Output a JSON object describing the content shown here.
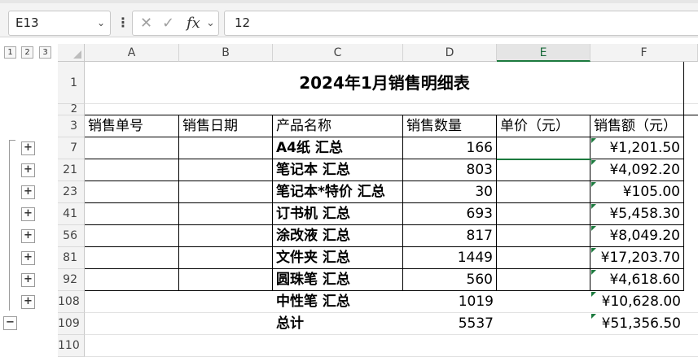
{
  "formula_bar": {
    "name_box": "E13",
    "more_glyph": "⋮",
    "cancel_glyph": "✕",
    "enter_glyph": "✓",
    "fx_label": "fx",
    "fx_dropdown": "⌄",
    "formula_value": "12"
  },
  "outline": {
    "levels": [
      "1",
      "2",
      "3"
    ],
    "expand_glyph": "+",
    "collapse_glyph": "−"
  },
  "columns": [
    "A",
    "B",
    "C",
    "D",
    "E",
    "F"
  ],
  "selected_column": "E",
  "rows": [
    "1",
    "2",
    "3",
    "7",
    "21",
    "23",
    "41",
    "56",
    "81",
    "92",
    "108",
    "109",
    "110"
  ],
  "sheet": {
    "title": "2024年1月销售明细表",
    "headers": [
      "销售单号",
      "销售日期",
      "产品名称",
      "销售数量",
      "单价（元）",
      "销售额（元）"
    ],
    "data": [
      {
        "name": "A4纸 汇总",
        "qty": "166",
        "amount": "¥1,201.50"
      },
      {
        "name": "笔记本 汇总",
        "qty": "803",
        "amount": "¥4,092.20"
      },
      {
        "name": "笔记本*特价 汇总",
        "qty": "30",
        "amount": "¥105.00"
      },
      {
        "name": "订书机 汇总",
        "qty": "693",
        "amount": "¥5,458.30"
      },
      {
        "name": "涂改液 汇总",
        "qty": "817",
        "amount": "¥8,049.20"
      },
      {
        "name": "文件夹 汇总",
        "qty": "1449",
        "amount": "¥17,203.70"
      },
      {
        "name": "圆珠笔 汇总",
        "qty": "560",
        "amount": "¥4,618.60"
      },
      {
        "name": "中性笔 汇总",
        "qty": "1019",
        "amount": "¥10,628.00"
      },
      {
        "name": "总计",
        "qty": "5537",
        "amount": "¥51,356.50"
      }
    ]
  },
  "colors": {
    "accent_green": "#1c7a3e",
    "header_bg": "#f3f3f3"
  }
}
